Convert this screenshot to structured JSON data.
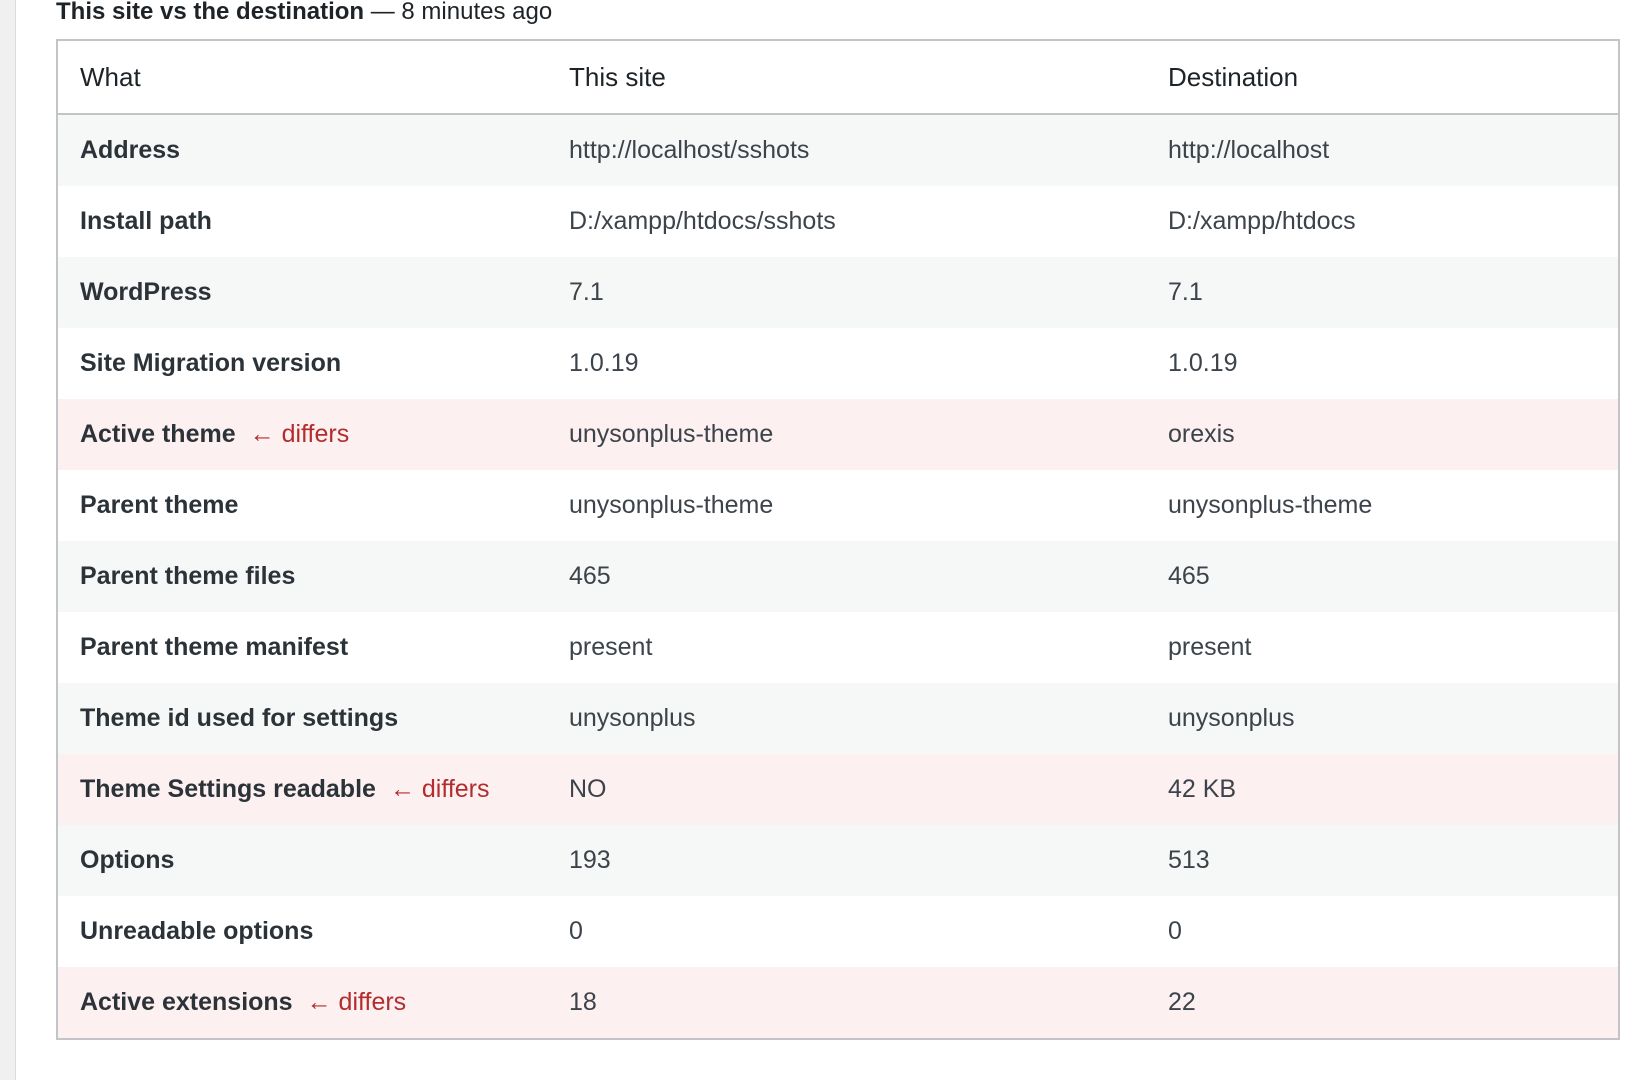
{
  "header": {
    "title": "This site vs the destination",
    "separator": "—",
    "age": "8 minutes ago"
  },
  "table": {
    "columns": [
      "What",
      "This site",
      "Destination"
    ],
    "differs_label": "← differs",
    "rows": [
      {
        "what": "Address",
        "this_site": "http://localhost/sshots",
        "destination": "http://localhost",
        "differs": false
      },
      {
        "what": "Install path",
        "this_site": "D:/xampp/htdocs/sshots",
        "destination": "D:/xampp/htdocs",
        "differs": false
      },
      {
        "what": "WordPress",
        "this_site": "7.1",
        "destination": "7.1",
        "differs": false
      },
      {
        "what": "Site Migration version",
        "this_site": "1.0.19",
        "destination": "1.0.19",
        "differs": false
      },
      {
        "what": "Active theme",
        "this_site": "unysonplus-theme",
        "destination": "orexis",
        "differs": true
      },
      {
        "what": "Parent theme",
        "this_site": "unysonplus-theme",
        "destination": "unysonplus-theme",
        "differs": false
      },
      {
        "what": "Parent theme files",
        "this_site": "465",
        "destination": "465",
        "differs": false
      },
      {
        "what": "Parent theme manifest",
        "this_site": "present",
        "destination": "present",
        "differs": false
      },
      {
        "what": "Theme id used for settings",
        "this_site": "unysonplus",
        "destination": "unysonplus",
        "differs": false
      },
      {
        "what": "Theme Settings readable",
        "this_site": "NO",
        "destination": "42 KB",
        "differs": true
      },
      {
        "what": "Options",
        "this_site": "193",
        "destination": "513",
        "differs": false
      },
      {
        "what": "Unreadable options",
        "this_site": "0",
        "destination": "0",
        "differs": false
      },
      {
        "what": "Active extensions",
        "this_site": "18",
        "destination": "22",
        "differs": true
      }
    ]
  },
  "colors": {
    "differs_text": "#b32d2e",
    "differs_row_bg": "#fcf0f1",
    "alt_row_bg": "#f6f7f7",
    "border": "#c3c4c7"
  }
}
